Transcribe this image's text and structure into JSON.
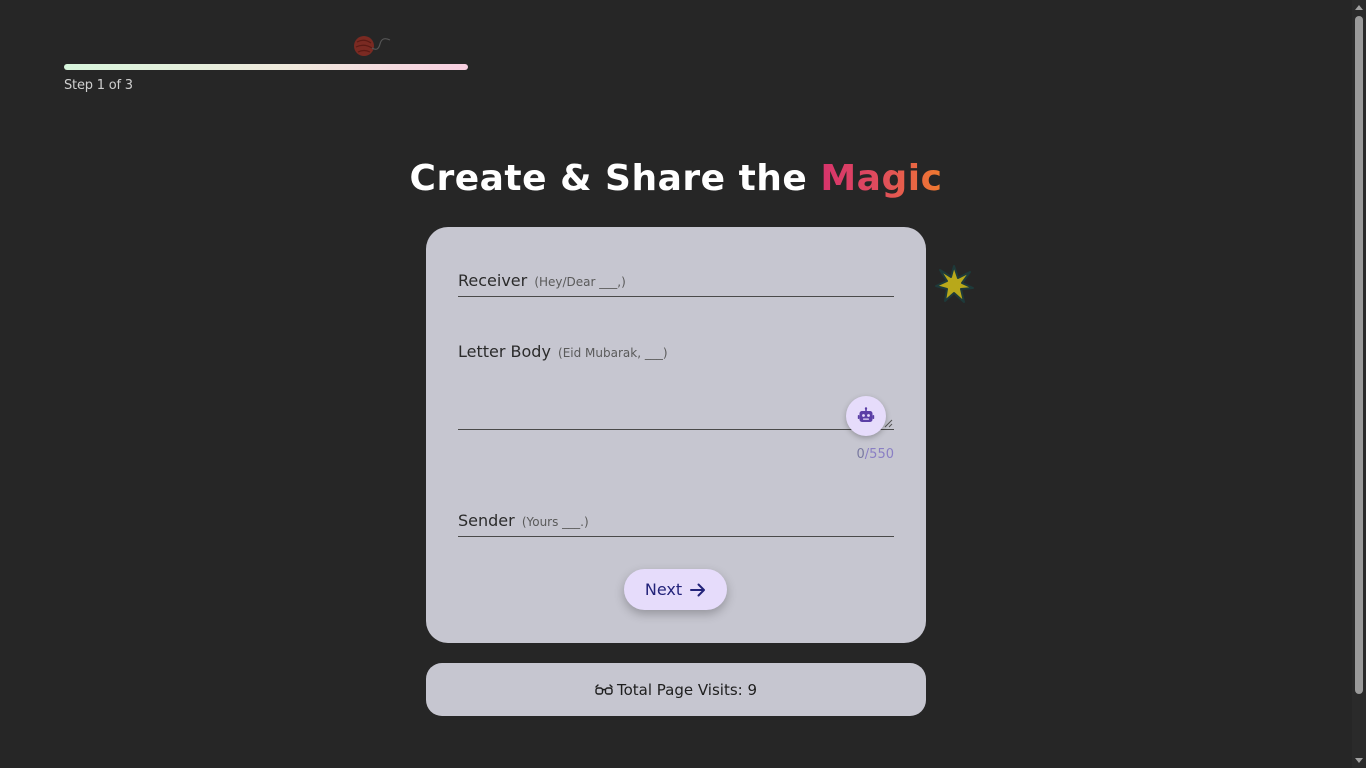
{
  "progress": {
    "step_label": "Step 1 of 3",
    "value": 0.33
  },
  "title": {
    "prefix": "Create & Share the ",
    "highlight": "Magic"
  },
  "form": {
    "receiver": {
      "label": "Receiver",
      "hint": "(Hey/Dear ___,)"
    },
    "letter_body": {
      "label": "Letter Body",
      "hint": "(Eid Mubarak, ___)"
    },
    "counter": {
      "current": "0",
      "max": "/550"
    },
    "sender": {
      "label": "Sender",
      "hint": "(Yours ___.)"
    },
    "next_label": "Next"
  },
  "visits": {
    "text": "Total Page Visits: 9"
  },
  "icons": {
    "progress_marker": "yarn-ball-icon",
    "ai_assist": "robot-icon",
    "next": "arrow-right-icon",
    "visits": "glasses-icon",
    "decoration": "star-burst-icon"
  },
  "colors": {
    "background": "#262626",
    "card": "#c6c6d0",
    "button": "#e6dcfb",
    "accent": "#d6336c"
  }
}
